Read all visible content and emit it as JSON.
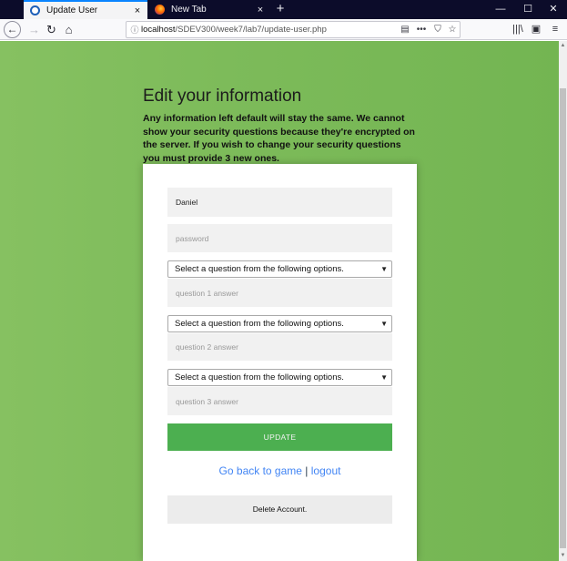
{
  "browser": {
    "tabs": [
      {
        "title": "Update User",
        "close": "×"
      },
      {
        "title": "New Tab",
        "close": "×"
      }
    ],
    "new_tab": "+",
    "window_controls": {
      "minimize": "—",
      "maximize": "☐",
      "close": "✕"
    },
    "nav": {
      "back": "←",
      "forward": "→",
      "reload": "↻",
      "home": "⌂"
    },
    "url": {
      "host": "localhost",
      "path": "/SDEV300/week7/lab7/update-user.php"
    },
    "url_icons": {
      "info": "ⓘ",
      "reader": "▤",
      "more": "•••",
      "pocket": "⛉",
      "bookmark": "☆"
    },
    "toolbar_icons": {
      "library": "|||\\",
      "sidebar": "▣",
      "menu": "≡"
    }
  },
  "page": {
    "heading": "Edit your information",
    "intro": "Any information left default will stay the same. We cannot show your security questions because they're encrypted on the server. If you wish to change your security questions you must provide 3 new ones.",
    "form": {
      "username_value": "Daniel",
      "password_placeholder": "password",
      "question_select_text": "Select a question from the following options.",
      "answer1_placeholder": "question 1 answer",
      "answer2_placeholder": "question 2 answer",
      "answer3_placeholder": "question 3 answer",
      "update_label": "UPDATE",
      "back_link": "Go back to game",
      "separator": "|",
      "logout_link": "logout",
      "delete_label": "Delete Account."
    }
  },
  "colors": {
    "page_background": "#7dbb5a",
    "update_button": "#4caf50",
    "link": "#4285f4",
    "field_background": "#f1f1f1"
  }
}
